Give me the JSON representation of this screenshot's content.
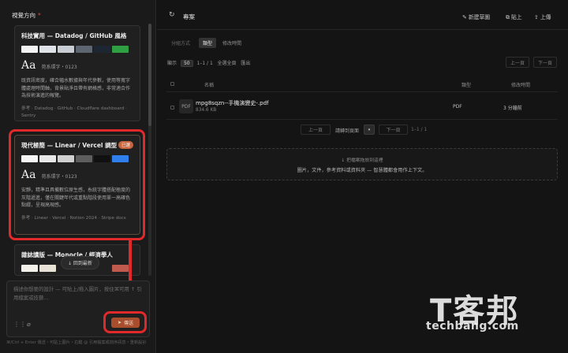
{
  "left_panel": {
    "title": "視覺方向",
    "required_mark": "*",
    "cards": [
      {
        "title": "科技實用 — Datadog / GitHub 風格",
        "swatches": [
          "#f4f4f4",
          "#dfe3e8",
          "#c9ced5",
          "#5c6570",
          "#1c2733",
          "#2ea043"
        ],
        "font_sample": "Aa",
        "font_desc": "苑系環字・0123",
        "body": "既資訊密度，確合幅水數據與年代參數，使用等寬字體處理時間軸，背景貼淨且帶有網格感，非常適合作為技術演進的報覽。",
        "ref": "參考 · Datadog · GitHub · Cloudflare dashboard · Sentry"
      },
      {
        "title": "現代極簡 — Linear / Vercel 調型",
        "badge": "已選",
        "swatches": [
          "#f5f5f5",
          "#e8e8e8",
          "#d0d0d0",
          "#5e5e5e",
          "#111111",
          "#2f80ed"
        ],
        "font_sample": "Aa",
        "font_desc": "苑系環字・0123",
        "body": "安靜，精準且具備數位原生感，糸統字體搭配極度的灰階遞進，僅在關鍵年代或重點階段使用單一高確色點綴，呈現高現感。",
        "ref": "參考 · Linear · Vercel · Notion 2024 · Stripe docs"
      },
      {
        "title": "雜誌讀版 — Monocle / 經濟學人",
        "swatches": [
          "#f4f1ea",
          "#e8e2d6",
          "#2a2a2a",
          "#c05a4e"
        ]
      }
    ],
    "back_to_latest": "↓ 回到最新",
    "input_placeholder": "描述你想要的設計 — 可貼上/拖入圖片，按住⌘可用 ↑ 引用檔案或技藝…",
    "send_label": "傳送",
    "footer_hint": "⌘/Ctrl + Enter 傳送・可貼上圖片・右鍵 @ 引用檔案或前序訊息・重新設計"
  },
  "toolbar": {
    "project_label": "專案",
    "new_sketch": "新建草圖",
    "paste": "貼上",
    "upload": "上傳"
  },
  "filter": {
    "label": "分組方式",
    "tabs": [
      "類型",
      "修改時間"
    ]
  },
  "display": {
    "label": "顯示",
    "selected": "50",
    "range": "1–1 / 1",
    "select_all": "全選全頁",
    "export": "匯出",
    "prev": "上一頁",
    "next": "下一頁"
  },
  "table": {
    "headers": [
      "名稱",
      "類型",
      "修改時間"
    ],
    "rows": [
      {
        "icon": "PDF",
        "name": "mpg8sqzn--手機演變史-.pdf",
        "size": "834.6 KB",
        "type": "PDF",
        "modified": "3 分鐘前"
      }
    ]
  },
  "pager": {
    "prev": "上一頁",
    "per_page": "請轉到頁面",
    "per_page_value": "▾",
    "next": "下一頁",
    "range": "1–1 / 1"
  },
  "dropzone": {
    "title": "↓ 把檔案拖放到這裡",
    "subtitle": "圖片，文件，參考資料或資料夾 — 智慧體都會用作上下文。"
  },
  "watermark": {
    "logo": "T客邦",
    "site": "techbang.com"
  }
}
